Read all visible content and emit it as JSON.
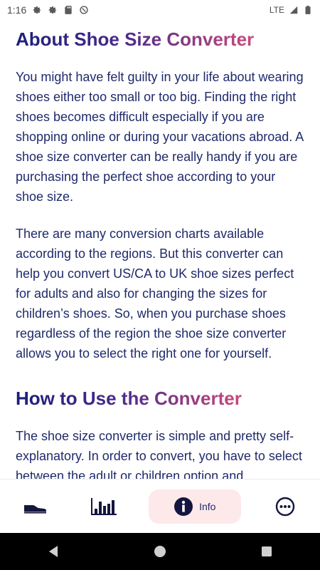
{
  "status_bar": {
    "time": "1:16",
    "network": "LTE"
  },
  "content": {
    "section1_title": "About Shoe Size Converter",
    "section1_p1": "You might have felt guilty in your life about wearing shoes either too small or too big. Finding the right shoes becomes difficult especially if you are shopping online or during your vacations abroad. A shoe size converter can be really handy if you are purchasing the perfect shoe according to your shoe size.",
    "section1_p2": "There are many conversion charts available according to the regions. But this converter can help you convert US/CA to UK shoe sizes perfect for adults and also for changing the sizes for children’s shoes. So, when you purchase shoes regardless of the region the shoe size converter allows you to select the right one for yourself.",
    "section2_title": "How to Use the Converter",
    "section2_p1": "The shoe size converter is simple and pretty self-explanatory. In order to convert, you have to select between the adult or children option and"
  },
  "bottom_nav": {
    "items": [
      {
        "icon": "shoe-icon"
      },
      {
        "icon": "bar-chart-icon"
      },
      {
        "icon": "info-icon",
        "label": "Info",
        "active": true
      },
      {
        "icon": "more-icon"
      }
    ],
    "active_bg": "#fde9ea",
    "icon_color": "#14163f"
  },
  "colors": {
    "heading_gradient_start": "#1b1f7a",
    "heading_gradient_end": "#c94a7d",
    "body_text": "#1f2a6b"
  }
}
